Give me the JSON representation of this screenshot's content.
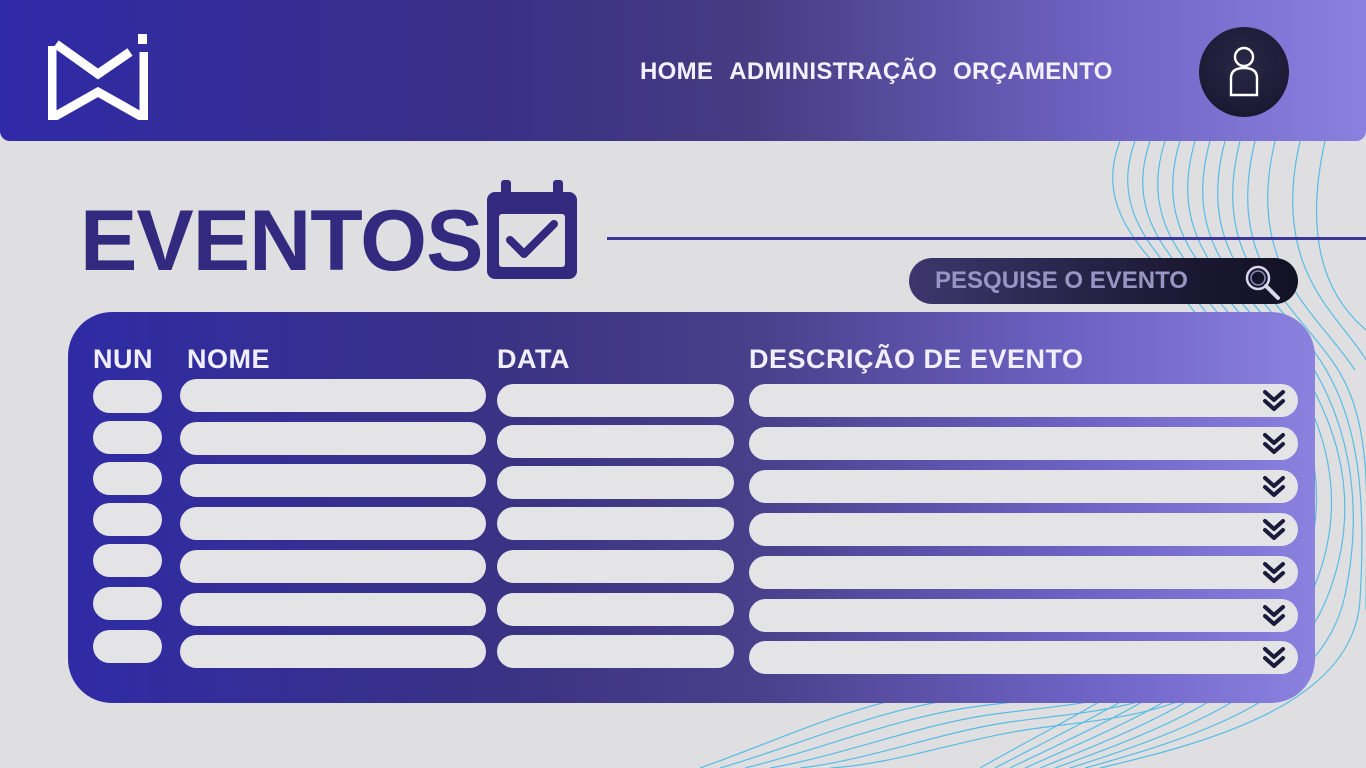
{
  "header": {
    "nav": [
      "HOME",
      "ADMINISTRAÇÃO",
      "ORÇAMENTO"
    ],
    "logo_icon": "logo-icon",
    "user_icon": "user-icon"
  },
  "title": {
    "text": "EVENTOS",
    "icon": "calendar-check-icon"
  },
  "search": {
    "placeholder": "PESQUISE O EVENTO",
    "value": "",
    "icon": "search-icon"
  },
  "table": {
    "columns": [
      "NUN",
      "NOME",
      "DATA",
      "DESCRIÇÃO DE EVENTO"
    ],
    "rows": [
      {
        "num": "",
        "nome": "",
        "data": "",
        "descricao": ""
      },
      {
        "num": "",
        "nome": "",
        "data": "",
        "descricao": ""
      },
      {
        "num": "",
        "nome": "",
        "data": "",
        "descricao": ""
      },
      {
        "num": "",
        "nome": "",
        "data": "",
        "descricao": ""
      },
      {
        "num": "",
        "nome": "",
        "data": "",
        "descricao": ""
      },
      {
        "num": "",
        "nome": "",
        "data": "",
        "descricao": ""
      },
      {
        "num": "",
        "nome": "",
        "data": "",
        "descricao": ""
      }
    ],
    "expand_icon": "double-chevron-down-icon"
  },
  "colors": {
    "primary": "#33297f",
    "header_start": "#2f2aa8",
    "header_end": "#8b80e0",
    "accent_wave": "#3fb6e6",
    "cell_bg": "#e4e3e6"
  }
}
